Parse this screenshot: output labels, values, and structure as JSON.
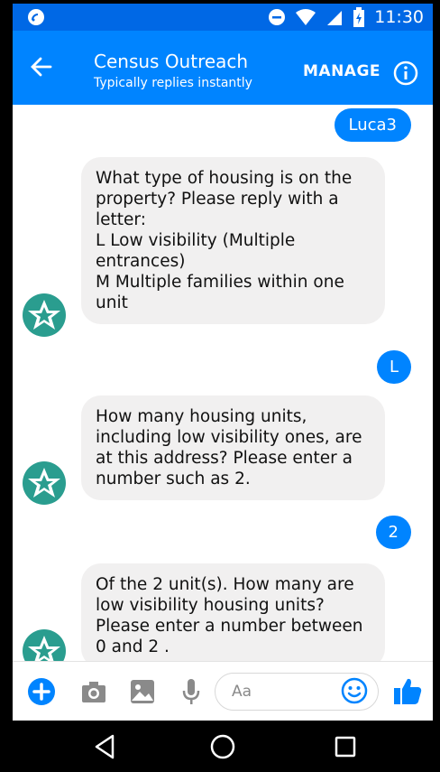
{
  "status_bar": {
    "time": "11:30"
  },
  "header": {
    "title": "Census Outreach",
    "subtitle": "Typically replies instantly",
    "manage_label": "MANAGE"
  },
  "messages": [
    {
      "side": "right",
      "text": "Luca3"
    },
    {
      "side": "left",
      "text": "What type of housing is on the property? Please reply with a letter:\nL Low visibility (Multiple entrances)\nM Multiple families within one unit"
    },
    {
      "side": "right",
      "text": "L"
    },
    {
      "side": "left",
      "text": "How many housing units, including low visibility ones, are at this address? Please enter a number such as 2."
    },
    {
      "side": "right",
      "text": "2"
    },
    {
      "side": "left",
      "text": "Of the 2 unit(s). How many are low visibility housing units? Please enter a number between 0 and 2 ."
    }
  ],
  "composer": {
    "placeholder": "Aa"
  },
  "colors": {
    "brand": "#0084ff",
    "status_bar": "#0068e5",
    "bubble_in": "#f1f0f0",
    "avatar": "#2a9d8f"
  },
  "icons": [
    "back-arrow-icon",
    "info-icon",
    "plus-icon",
    "camera-icon",
    "image-icon",
    "microphone-icon",
    "emoji-icon",
    "thumbs-up-icon",
    "nav-back-icon",
    "nav-home-icon",
    "nav-recents-icon"
  ]
}
